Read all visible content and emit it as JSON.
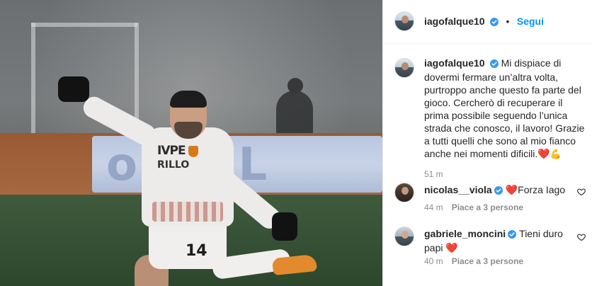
{
  "post": {
    "author": "iagofalque10",
    "follow_label": "Segui",
    "more_label": "•••",
    "dot": "•",
    "photo": {
      "board_text": "o GEL",
      "sponsor_line1": "IVPE",
      "sponsor_line2": "RILLO",
      "shirt_number": "14"
    },
    "caption": {
      "username": "iagofalque10",
      "text": "Mi dispiace di dovermi fermare un’altra volta, purtroppo anche questo fa parte del gioco. Cercherò di recuperare il prima possibile seguendo l’unica strada che conosco, il lavoro! Grazie a tutti quelli che sono al mio fianco anche nei momenti dificili.",
      "emoji_heart": "❤️",
      "emoji_muscle": "💪",
      "time": "51 m"
    },
    "comments": [
      {
        "username": "nicolas__viola",
        "verified": true,
        "emoji": "❤️",
        "text": "Forza Iago",
        "time": "44 m",
        "likes": "Piace a 3 persone"
      },
      {
        "username": "gabriele_moncini",
        "verified": true,
        "text": "Tieni duro papi",
        "emoji": "❤️",
        "time": "40 m",
        "likes": "Piace a 3 persone"
      }
    ]
  },
  "colors": {
    "accent": "#0095f6",
    "muted": "#8e8e8e",
    "text": "#262626",
    "border": "#efefef",
    "heart": "#e0245e"
  },
  "icons": {
    "verified": "verified-badge-icon",
    "like": "heart-outline-icon",
    "more": "more-options-icon"
  }
}
